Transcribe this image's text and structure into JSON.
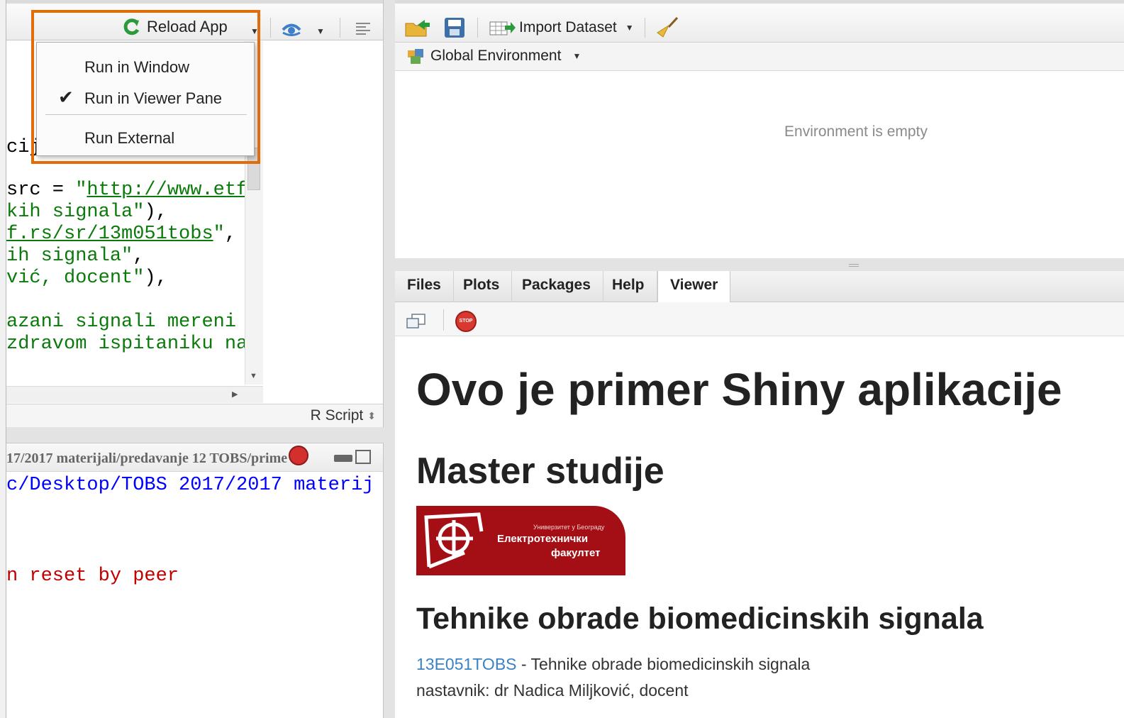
{
  "editor": {
    "toolbar": {
      "reload_label": "Reload App"
    },
    "code_lines": [
      {
        "segments": [
          {
            "text": "ci",
            "cls": "c-black"
          },
          {
            "text": "j",
            "cls": "c-black"
          }
        ]
      },
      {
        "segments": [
          {
            "text": "src",
            "cls": "c-black"
          },
          {
            "text": " = ",
            "cls": "c-black"
          },
          {
            "text": "\"",
            "cls": "c-green"
          },
          {
            "text": "http://www.etf",
            "cls": "c-link"
          }
        ]
      },
      {
        "segments": [
          {
            "text": "kih signala\"",
            "cls": "c-green"
          },
          {
            "text": "),",
            "cls": "c-black"
          }
        ]
      },
      {
        "segments": [
          {
            "text": "f.rs/sr/13m051tobs",
            "cls": "c-link"
          },
          {
            "text": "\"",
            "cls": "c-green"
          },
          {
            "text": ",",
            "cls": "c-black"
          }
        ]
      },
      {
        "segments": [
          {
            "text": "ih signala\"",
            "cls": "c-green"
          },
          {
            "text": ",",
            "cls": "c-black"
          }
        ]
      },
      {
        "segments": [
          {
            "text": "vić, docent\"",
            "cls": "c-green"
          },
          {
            "text": "),",
            "cls": "c-black"
          }
        ]
      },
      {
        "segments": [
          {
            "text": "azani signali mereni",
            "cls": "c-green"
          }
        ]
      },
      {
        "segments": [
          {
            "text": "zdravom ispitaniku na",
            "cls": "c-green"
          }
        ]
      }
    ],
    "file_type": "R Script"
  },
  "run_menu": {
    "items": [
      {
        "label": "Run in Window",
        "checked": false
      },
      {
        "label": "Run in Viewer Pane",
        "checked": true
      },
      {
        "label": "Run External",
        "checked": false
      }
    ]
  },
  "console": {
    "header_path": "17/2017 materijali/predavanje 12 TOBS/prime",
    "path_line": "c/Desktop/TOBS 2017/2017 materij",
    "error_line": "n reset by peer"
  },
  "environment": {
    "import_label": "Import Dataset",
    "scope_label": "Global Environment",
    "empty_message": "Environment is empty"
  },
  "tabs": [
    {
      "label": "Files",
      "active": false
    },
    {
      "label": "Plots",
      "active": false
    },
    {
      "label": "Packages",
      "active": false
    },
    {
      "label": "Help",
      "active": false
    },
    {
      "label": "Viewer",
      "active": true
    }
  ],
  "viewer": {
    "title": "Ovo je primer Shiny aplikacije",
    "subtitle": "Master studije",
    "logo_text": {
      "small": "Универзитет у Београду",
      "line1": "Електротехнички",
      "line2": "факултет"
    },
    "course_heading": "Tehnike obrade biomedicinskih signala",
    "course_code": "13E051TOBS",
    "course_desc": " - Tehnike obrade biomedicinskih signala",
    "teacher": "nastavnik: dr Nadica Miljković, docent"
  },
  "colors": {
    "highlight": "#e36c0a",
    "logo_bg": "#a30f14",
    "link": "#3b82c4",
    "console_path": "#0000ff",
    "console_error": "#c00000"
  }
}
